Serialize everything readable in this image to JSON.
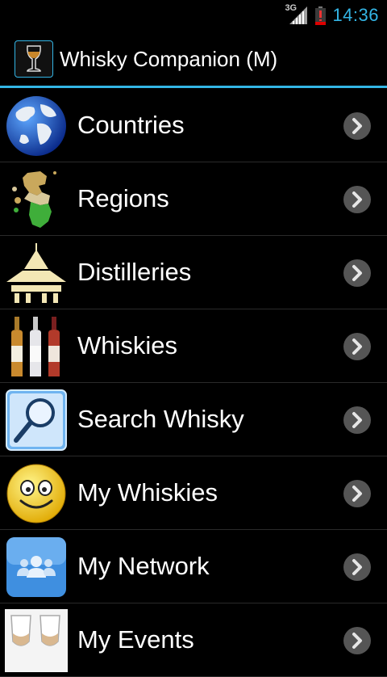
{
  "status_bar": {
    "network": "3G",
    "time": "14:36",
    "accent": "#33b5e5"
  },
  "app_bar": {
    "title": "Whisky Companion (M)",
    "icon": "whisky-glass-icon"
  },
  "menu": {
    "items": [
      {
        "label": "Countries",
        "icon": "globe-icon"
      },
      {
        "label": "Regions",
        "icon": "scotland-map-icon"
      },
      {
        "label": "Distilleries",
        "icon": "pagoda-icon"
      },
      {
        "label": "Whiskies",
        "icon": "bottles-icon"
      },
      {
        "label": "Search Whisky",
        "icon": "magnifier-icon"
      },
      {
        "label": "My Whiskies",
        "icon": "smiley-icon"
      },
      {
        "label": "My Network",
        "icon": "people-icon"
      },
      {
        "label": "My Events",
        "icon": "glasses-icon"
      }
    ]
  }
}
